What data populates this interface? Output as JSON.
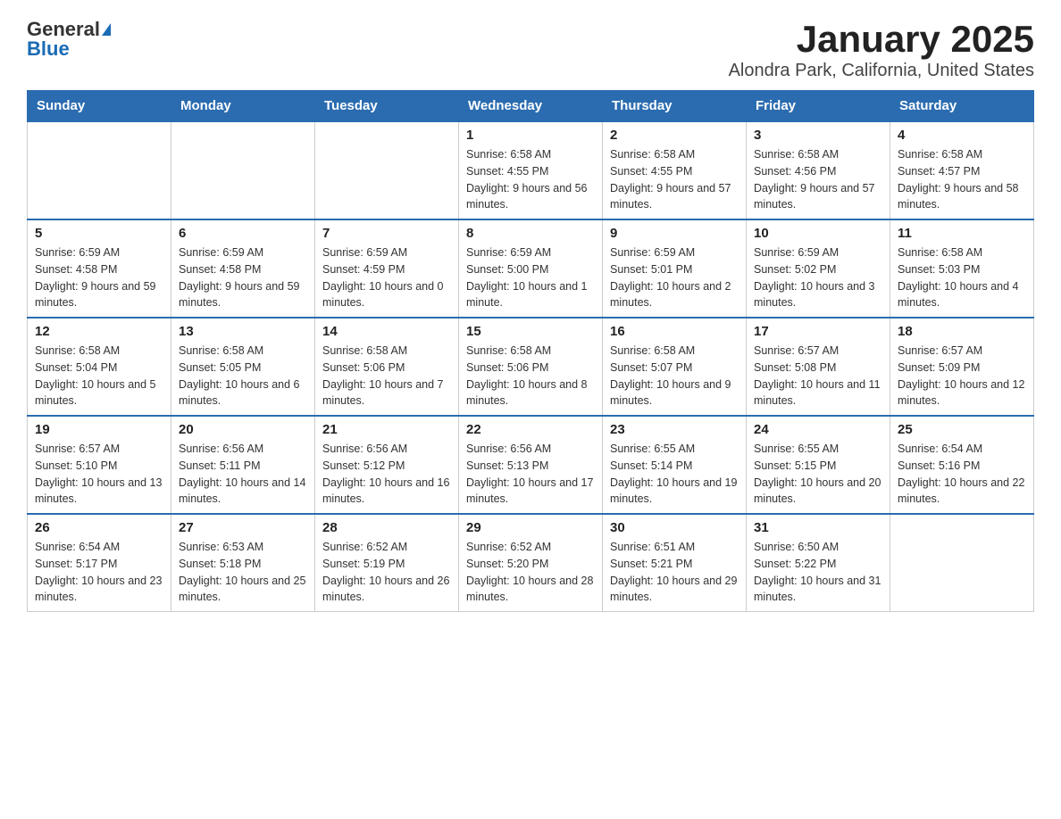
{
  "header": {
    "logo_general": "General",
    "logo_blue": "Blue",
    "title": "January 2025",
    "subtitle": "Alondra Park, California, United States"
  },
  "days_of_week": [
    "Sunday",
    "Monday",
    "Tuesday",
    "Wednesday",
    "Thursday",
    "Friday",
    "Saturday"
  ],
  "weeks": [
    [
      {
        "day": "",
        "info": ""
      },
      {
        "day": "",
        "info": ""
      },
      {
        "day": "",
        "info": ""
      },
      {
        "day": "1",
        "info": "Sunrise: 6:58 AM\nSunset: 4:55 PM\nDaylight: 9 hours and 56 minutes."
      },
      {
        "day": "2",
        "info": "Sunrise: 6:58 AM\nSunset: 4:55 PM\nDaylight: 9 hours and 57 minutes."
      },
      {
        "day": "3",
        "info": "Sunrise: 6:58 AM\nSunset: 4:56 PM\nDaylight: 9 hours and 57 minutes."
      },
      {
        "day": "4",
        "info": "Sunrise: 6:58 AM\nSunset: 4:57 PM\nDaylight: 9 hours and 58 minutes."
      }
    ],
    [
      {
        "day": "5",
        "info": "Sunrise: 6:59 AM\nSunset: 4:58 PM\nDaylight: 9 hours and 59 minutes."
      },
      {
        "day": "6",
        "info": "Sunrise: 6:59 AM\nSunset: 4:58 PM\nDaylight: 9 hours and 59 minutes."
      },
      {
        "day": "7",
        "info": "Sunrise: 6:59 AM\nSunset: 4:59 PM\nDaylight: 10 hours and 0 minutes."
      },
      {
        "day": "8",
        "info": "Sunrise: 6:59 AM\nSunset: 5:00 PM\nDaylight: 10 hours and 1 minute."
      },
      {
        "day": "9",
        "info": "Sunrise: 6:59 AM\nSunset: 5:01 PM\nDaylight: 10 hours and 2 minutes."
      },
      {
        "day": "10",
        "info": "Sunrise: 6:59 AM\nSunset: 5:02 PM\nDaylight: 10 hours and 3 minutes."
      },
      {
        "day": "11",
        "info": "Sunrise: 6:58 AM\nSunset: 5:03 PM\nDaylight: 10 hours and 4 minutes."
      }
    ],
    [
      {
        "day": "12",
        "info": "Sunrise: 6:58 AM\nSunset: 5:04 PM\nDaylight: 10 hours and 5 minutes."
      },
      {
        "day": "13",
        "info": "Sunrise: 6:58 AM\nSunset: 5:05 PM\nDaylight: 10 hours and 6 minutes."
      },
      {
        "day": "14",
        "info": "Sunrise: 6:58 AM\nSunset: 5:06 PM\nDaylight: 10 hours and 7 minutes."
      },
      {
        "day": "15",
        "info": "Sunrise: 6:58 AM\nSunset: 5:06 PM\nDaylight: 10 hours and 8 minutes."
      },
      {
        "day": "16",
        "info": "Sunrise: 6:58 AM\nSunset: 5:07 PM\nDaylight: 10 hours and 9 minutes."
      },
      {
        "day": "17",
        "info": "Sunrise: 6:57 AM\nSunset: 5:08 PM\nDaylight: 10 hours and 11 minutes."
      },
      {
        "day": "18",
        "info": "Sunrise: 6:57 AM\nSunset: 5:09 PM\nDaylight: 10 hours and 12 minutes."
      }
    ],
    [
      {
        "day": "19",
        "info": "Sunrise: 6:57 AM\nSunset: 5:10 PM\nDaylight: 10 hours and 13 minutes."
      },
      {
        "day": "20",
        "info": "Sunrise: 6:56 AM\nSunset: 5:11 PM\nDaylight: 10 hours and 14 minutes."
      },
      {
        "day": "21",
        "info": "Sunrise: 6:56 AM\nSunset: 5:12 PM\nDaylight: 10 hours and 16 minutes."
      },
      {
        "day": "22",
        "info": "Sunrise: 6:56 AM\nSunset: 5:13 PM\nDaylight: 10 hours and 17 minutes."
      },
      {
        "day": "23",
        "info": "Sunrise: 6:55 AM\nSunset: 5:14 PM\nDaylight: 10 hours and 19 minutes."
      },
      {
        "day": "24",
        "info": "Sunrise: 6:55 AM\nSunset: 5:15 PM\nDaylight: 10 hours and 20 minutes."
      },
      {
        "day": "25",
        "info": "Sunrise: 6:54 AM\nSunset: 5:16 PM\nDaylight: 10 hours and 22 minutes."
      }
    ],
    [
      {
        "day": "26",
        "info": "Sunrise: 6:54 AM\nSunset: 5:17 PM\nDaylight: 10 hours and 23 minutes."
      },
      {
        "day": "27",
        "info": "Sunrise: 6:53 AM\nSunset: 5:18 PM\nDaylight: 10 hours and 25 minutes."
      },
      {
        "day": "28",
        "info": "Sunrise: 6:52 AM\nSunset: 5:19 PM\nDaylight: 10 hours and 26 minutes."
      },
      {
        "day": "29",
        "info": "Sunrise: 6:52 AM\nSunset: 5:20 PM\nDaylight: 10 hours and 28 minutes."
      },
      {
        "day": "30",
        "info": "Sunrise: 6:51 AM\nSunset: 5:21 PM\nDaylight: 10 hours and 29 minutes."
      },
      {
        "day": "31",
        "info": "Sunrise: 6:50 AM\nSunset: 5:22 PM\nDaylight: 10 hours and 31 minutes."
      },
      {
        "day": "",
        "info": ""
      }
    ]
  ]
}
